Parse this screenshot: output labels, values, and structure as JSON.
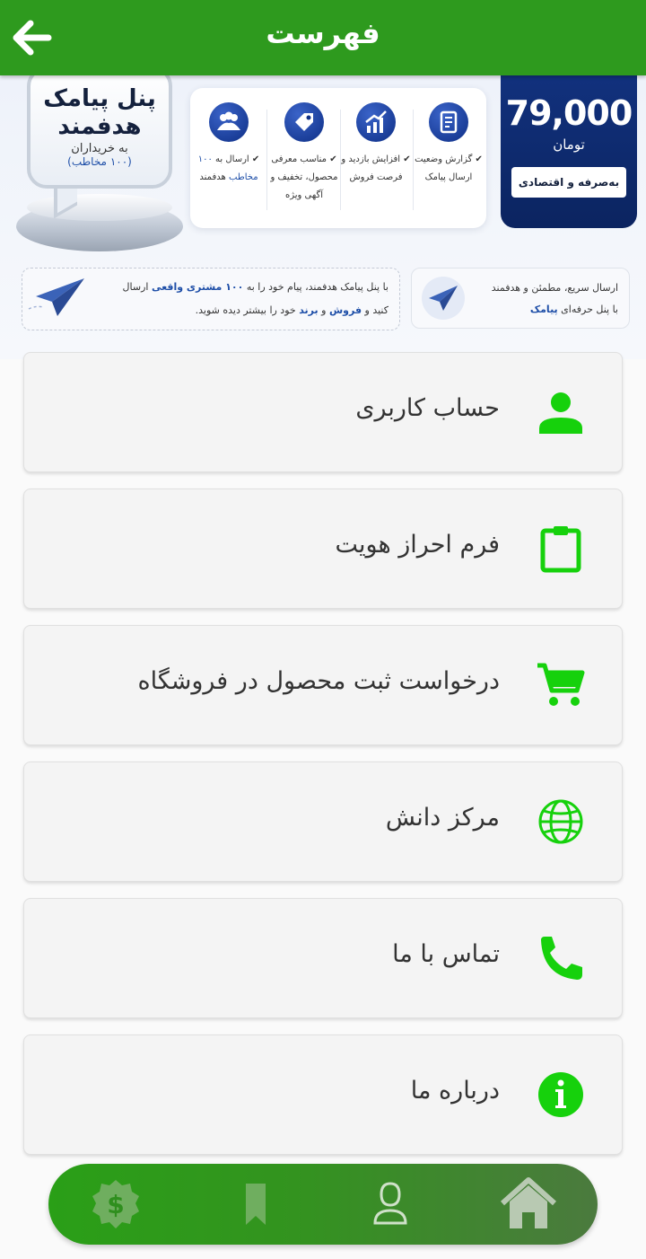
{
  "appbar": {
    "title": "فهرست",
    "back_icon": "arrow-left-icon"
  },
  "banner": {
    "bubble": {
      "line1": "پنل پیامک",
      "line2": "هدفمند",
      "line3": "به خریداران",
      "line4": "(۱۰۰ مخاطب)"
    },
    "features": [
      {
        "icon": "report-icon",
        "text": "✔ گزارش وضعیت ارسال پیامک"
      },
      {
        "icon": "growth-chart-icon",
        "text": "✔ افزایش بازدید و فرصت فروش"
      },
      {
        "icon": "tag-icon",
        "text": "✔ مناسب معرفی محصول، تخفیف و آگهی ویژه"
      },
      {
        "icon": "people-icon",
        "text_prefix": "✔ ارسال به ",
        "text_highlight": "۱۰۰ مخاطب",
        "text_suffix": " هدفمند"
      }
    ],
    "price": {
      "amount": "79,000",
      "currency": "تومان",
      "ribbon": "به‌صرفه و اقتصادی"
    },
    "info_right": {
      "line1": "ارسال سریع، مطمئن و هدفمند",
      "line2_prefix": "با پنل حرفه‌ای ",
      "line2_highlight": "پیامک"
    },
    "info_left": {
      "p1": "با پنل پیامک هدفمند، پیام خود را به ",
      "h1": "۱۰۰ مشتری واقعی",
      "p2": " ارسال کنید و ",
      "h2": "فروش",
      "p3": " و ",
      "h3": "برند",
      "p4": " خود را بیشتر دیده شوید."
    }
  },
  "menu": {
    "items": [
      {
        "label": "حساب کاربری",
        "icon": "user-icon"
      },
      {
        "label": "فرم احراز هویت",
        "icon": "clipboard-icon"
      },
      {
        "label": "درخواست ثبت محصول در فروشگاه",
        "icon": "cart-icon"
      },
      {
        "label": "مرکز دانش",
        "icon": "globe-icon"
      },
      {
        "label": "تماس با ما",
        "icon": "phone-icon"
      },
      {
        "label": "درباره ما",
        "icon": "info-icon"
      }
    ]
  },
  "bottom_nav": {
    "items": [
      "wallet-badge-icon",
      "bookmark-icon",
      "profile-icon",
      "home-icon"
    ]
  },
  "colors": {
    "primary": "#2e9a1e",
    "icon_green": "#16d10c",
    "banner_blue": "#12327f"
  }
}
